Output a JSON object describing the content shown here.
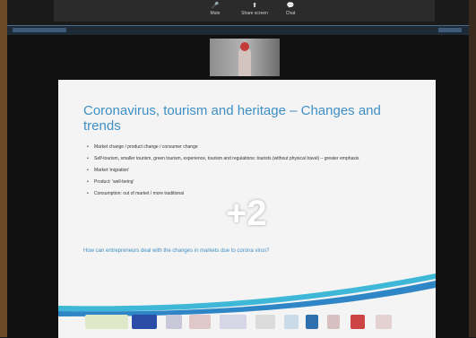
{
  "top_controls": [
    {
      "label": "Mute",
      "icon": "mic-icon"
    },
    {
      "label": "Share screen",
      "icon": "share-screen-icon"
    },
    {
      "label": "Chat",
      "icon": "chat-icon"
    }
  ],
  "slide": {
    "title": "Coronavirus, tourism and heritage – Changes and trends",
    "bullets": [
      "Market change / product change / consumer change",
      "Self-tourism, smaller tourism, green tourism, experience, tourism and regulations: tourists (without physical travel) – greater emphasis",
      "Market 'migration'",
      "Product: 'well-being'",
      "Consumption: out of market / more traditional"
    ],
    "question": "How can entrepreneurs deal with the changes in markets due to corona virus?"
  },
  "overlay_count": "+2",
  "colors": {
    "title_blue": "#3f8fc4",
    "wave_blue": "#2f86c6",
    "wave_cyan": "#3fb8d8",
    "slide_bg": "#f4f4f4"
  }
}
